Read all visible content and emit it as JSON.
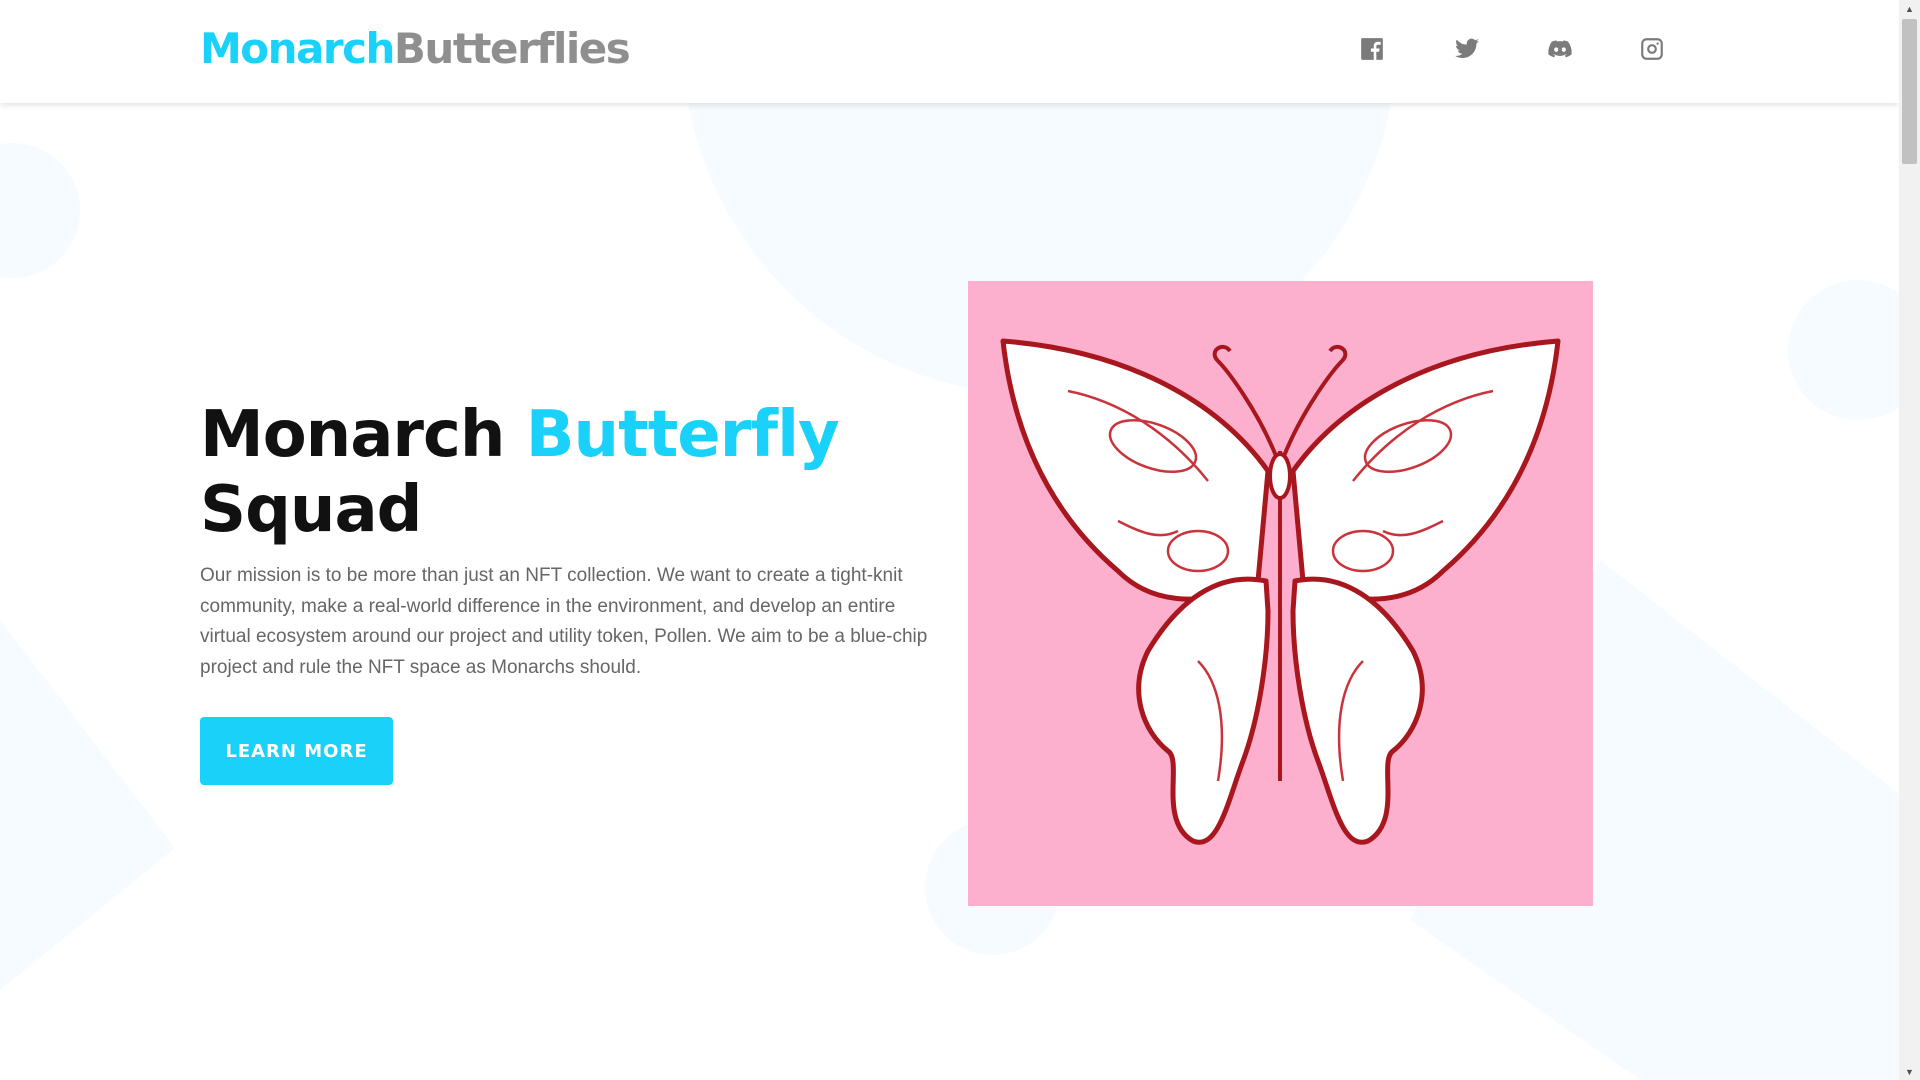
{
  "header": {
    "logo_primary": "Monarch",
    "logo_secondary": "Butterflies",
    "social": [
      {
        "icon": "facebook-icon"
      },
      {
        "icon": "twitter-icon"
      },
      {
        "icon": "discord-icon"
      },
      {
        "icon": "instagram-icon"
      }
    ]
  },
  "hero": {
    "title_part1": "Monarch ",
    "title_accent": "Butterfly",
    "title_part2": "Squad",
    "description": "Our mission is to be more than just an NFT collection. We want to create a tight-knit community, make a real-world difference in the environment, and develop an entire virtual ecosystem around our project and utility token, Pollen. We aim to be a blue-chip project and rule the NFT space as Monarchs should.",
    "cta_label": "LEARN MORE",
    "image": "butterfly-artwork"
  },
  "colors": {
    "accent": "#1ad2f9",
    "logo_gray": "#8f8f8f",
    "art_background": "#fdb0cd",
    "art_stroke": "#a8161e",
    "background_shape": "#f5fbfe"
  },
  "scrollbar": {
    "up_arrow": "▲",
    "down_arrow": "▼"
  }
}
